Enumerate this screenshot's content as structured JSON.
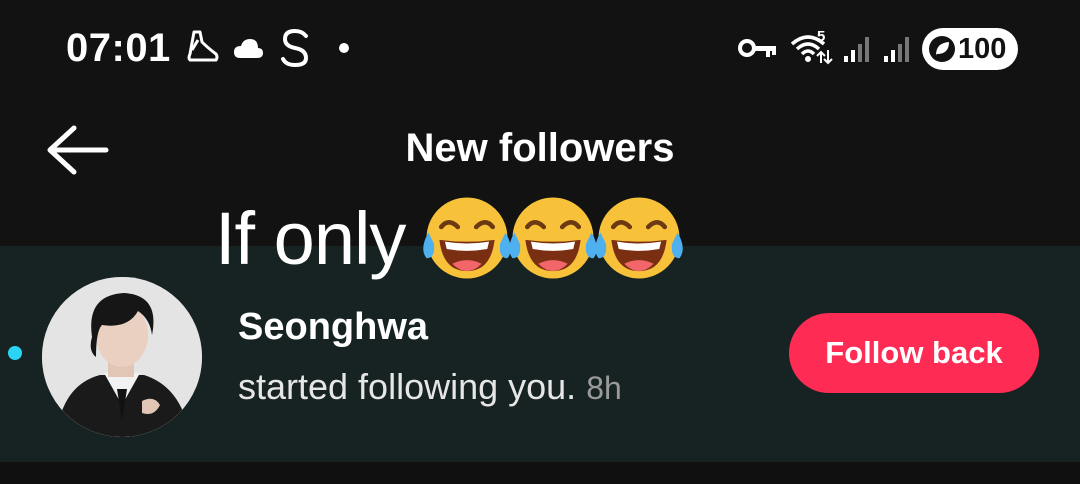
{
  "status_bar": {
    "time": "07:01",
    "left_icons": [
      "running-shoe-icon",
      "cloud-icon",
      "s-app-icon",
      "notification-dot-icon"
    ],
    "right_icons": [
      "vpn-key-icon",
      "wifi-icon",
      "signal-icon",
      "signal-icon"
    ],
    "wifi_badge": "5",
    "battery_level": "100"
  },
  "header": {
    "back_icon": "arrow-left-icon",
    "title": "New followers"
  },
  "overlay": {
    "caption": "If only",
    "emojis": [
      "face-with-tears-of-joy",
      "face-with-tears-of-joy",
      "face-with-tears-of-joy"
    ]
  },
  "follower": {
    "username": "Seonghwa",
    "activity": "started following you.",
    "time": "8h",
    "unread": true,
    "button_label": "Follow back"
  },
  "colors": {
    "background": "#121212",
    "row_background": "#172323",
    "accent": "#fe2c55",
    "unread_dot": "#2bd4f3"
  }
}
